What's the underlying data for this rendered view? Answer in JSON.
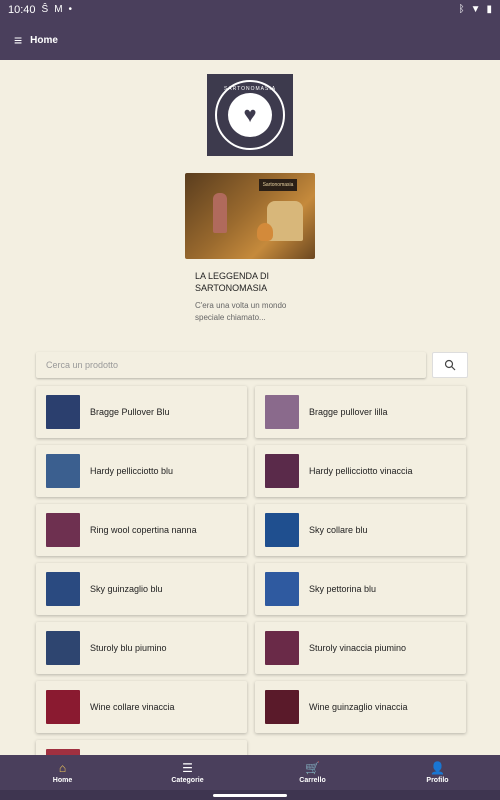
{
  "status_bar": {
    "time": "10:40",
    "left_icons": [
      "s-icon",
      "gmail-icon",
      "dot-icon"
    ],
    "right_icons": [
      "bluetooth-icon",
      "wifi-icon",
      "battery-icon"
    ]
  },
  "app_bar": {
    "title": "Home"
  },
  "logo": {
    "text": "SARTONOMASIA"
  },
  "post": {
    "title": "LA LEGGENDA DI SARTONOMASIA",
    "excerpt": "C'era una volta un mondo speciale chiamato...",
    "banner_sign": "Sartonomasia"
  },
  "search": {
    "placeholder": "Cerca un prodotto"
  },
  "products": [
    {
      "name": "Bragge Pullover Blu",
      "thumb_color": "#2b3f6e"
    },
    {
      "name": "Bragge pullover lilla",
      "thumb_color": "#8a6a8c"
    },
    {
      "name": "Hardy pellicciotto blu",
      "thumb_color": "#3b5f8f"
    },
    {
      "name": "Hardy pellicciotto vinaccia",
      "thumb_color": "#5a2a4a"
    },
    {
      "name": "Ring wool copertina nanna",
      "thumb_color": "#6e3050"
    },
    {
      "name": "Sky collare blu",
      "thumb_color": "#1f4f8f"
    },
    {
      "name": "Sky guinzaglio blu",
      "thumb_color": "#2a4a80"
    },
    {
      "name": "Sky pettorina blu",
      "thumb_color": "#2f5aa0"
    },
    {
      "name": "Sturoly blu piumino",
      "thumb_color": "#2e4570"
    },
    {
      "name": "Sturoly vinaccia piumino",
      "thumb_color": "#6a2a48"
    },
    {
      "name": "Wine collare vinaccia",
      "thumb_color": "#8a1a30"
    },
    {
      "name": "Wine guinzaglio vinaccia",
      "thumb_color": "#5a1a2a"
    },
    {
      "name": "",
      "thumb_color": "#a03040"
    }
  ],
  "bottom_nav": [
    {
      "label": "Home",
      "icon": "home-icon",
      "active": true
    },
    {
      "label": "Categorie",
      "icon": "list-icon",
      "active": false
    },
    {
      "label": "Carrello",
      "icon": "cart-icon",
      "active": false
    },
    {
      "label": "Profilo",
      "icon": "person-icon",
      "active": false
    }
  ],
  "colors": {
    "primary": "#4a3f5c",
    "background": "#f3efe1",
    "active_nav": "#f1c75a"
  }
}
